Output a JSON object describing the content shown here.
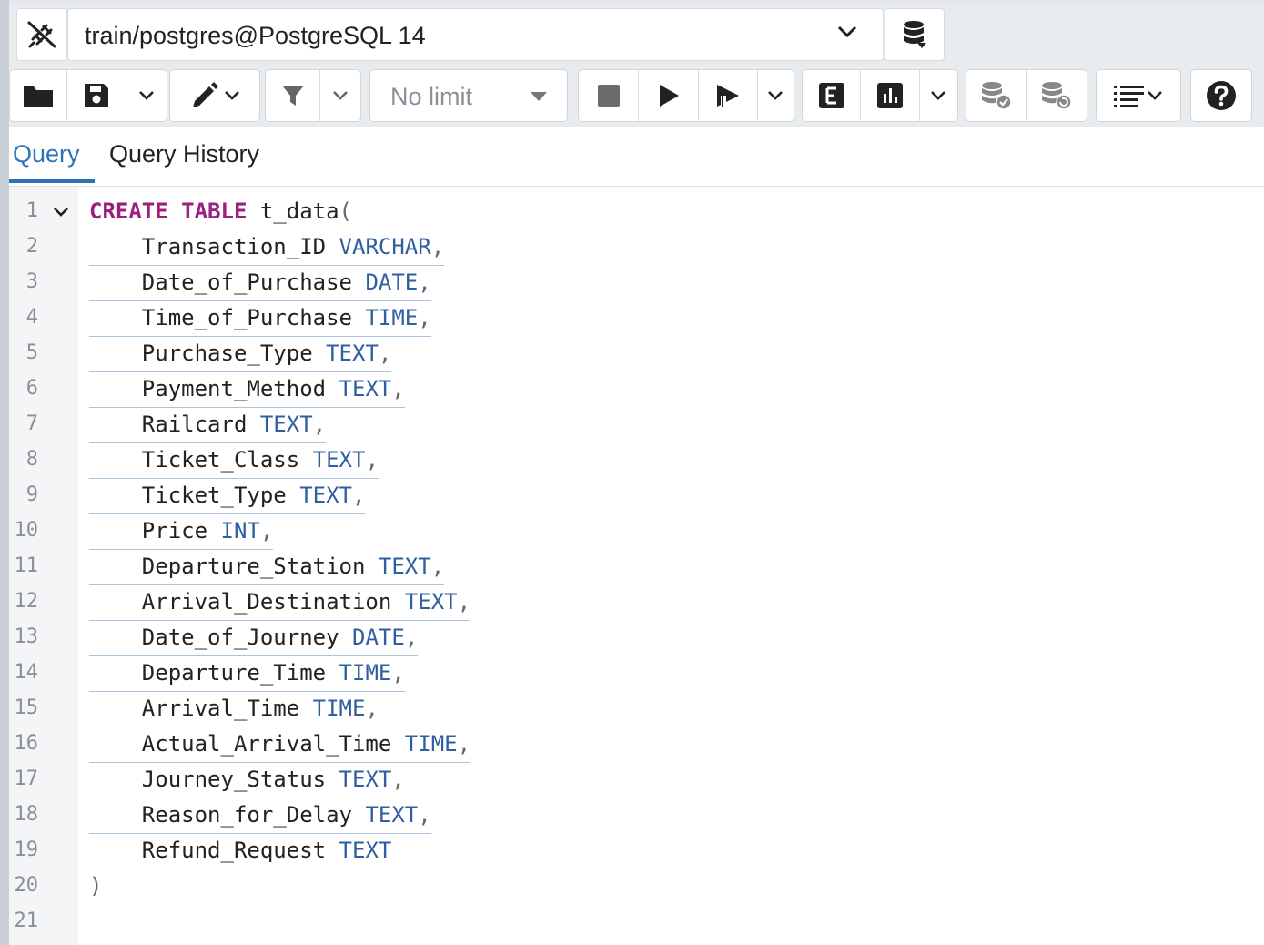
{
  "connection": {
    "label": "train/postgres@PostgreSQL 14"
  },
  "toolbar": {
    "row_limit": "No limit"
  },
  "tabs": [
    {
      "label": "Query",
      "active": true
    },
    {
      "label": "Query History",
      "active": false
    }
  ],
  "editor": {
    "line_numbers": [
      "1",
      "2",
      "3",
      "4",
      "5",
      "6",
      "7",
      "8",
      "9",
      "10",
      "11",
      "12",
      "13",
      "14",
      "15",
      "16",
      "17",
      "18",
      "19",
      "20",
      "21"
    ],
    "lines": [
      {
        "keywords": "CREATE TABLE",
        "name": "t_data",
        "paren": "("
      },
      {
        "name": "Transaction_ID",
        "type": "VARCHAR",
        "sep": ","
      },
      {
        "name": "Date_of_Purchase",
        "type": "DATE",
        "sep": ","
      },
      {
        "name": "Time_of_Purchase",
        "type": "TIME",
        "sep": ","
      },
      {
        "name": "Purchase_Type",
        "type": "TEXT",
        "sep": ","
      },
      {
        "name": "Payment_Method",
        "type": "TEXT",
        "sep": ","
      },
      {
        "name": "Railcard",
        "type": "TEXT",
        "sep": ","
      },
      {
        "name": "Ticket_Class",
        "type": "TEXT",
        "sep": ","
      },
      {
        "name": "Ticket_Type",
        "type": "TEXT",
        "sep": ","
      },
      {
        "name": "Price",
        "type": "INT",
        "sep": ","
      },
      {
        "name": "Departure_Station",
        "type": "TEXT",
        "sep": ","
      },
      {
        "name": "Arrival_Destination",
        "type": "TEXT",
        "sep": ","
      },
      {
        "name": "Date_of_Journey",
        "type": "DATE",
        "sep": ","
      },
      {
        "name": "Departure_Time",
        "type": "TIME",
        "sep": ","
      },
      {
        "name": "Arrival_Time",
        "type": "TIME",
        "sep": ","
      },
      {
        "name": "Actual_Arrival_Time",
        "type": "TIME",
        "sep": ","
      },
      {
        "name": "Journey_Status",
        "type": "TEXT",
        "sep": ","
      },
      {
        "name": "Reason_for_Delay",
        "type": "TEXT",
        "sep": ","
      },
      {
        "name": "Refund_Request",
        "type": "TEXT",
        "sep": ""
      },
      {
        "paren": ")"
      }
    ]
  },
  "colors": {
    "accent": "#2a74b9",
    "keyword": "#9b1f7d",
    "datatype": "#2f5fa0"
  }
}
